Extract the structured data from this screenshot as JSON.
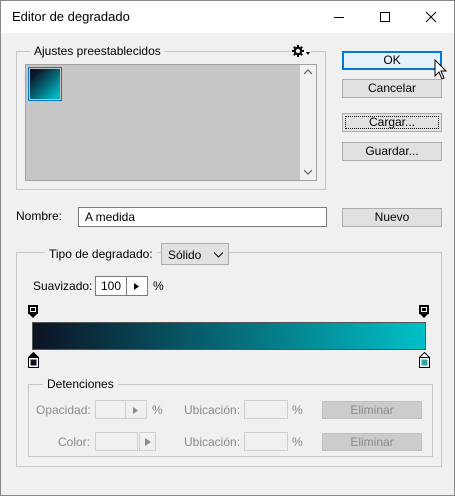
{
  "window": {
    "title": "Editor de degradado"
  },
  "presets": {
    "legend": "Ajustes preestablecidos",
    "gear_icon": "gear-icon",
    "selected_preset": {
      "from": "#0b1628",
      "to": "#00b7c3"
    }
  },
  "buttons": {
    "ok": "OK",
    "cancel": "Cancelar",
    "load": "Cargar...",
    "save": "Guardar...",
    "new": "Nuevo"
  },
  "name": {
    "label": "Nombre:",
    "value": "A medida"
  },
  "gradient_type": {
    "label": "Tipo de degradado:",
    "value": "Sólido"
  },
  "smoothness": {
    "label": "Suavizado:",
    "value": "100",
    "unit": "%"
  },
  "gradient": {
    "from": "#0c1324",
    "to": "#00c0c8"
  },
  "stops": {
    "legend": "Detenciones",
    "opacity_label": "Opacidad:",
    "opacity_unit": "%",
    "location_label_1": "Ubicación:",
    "location_unit_1": "%",
    "delete_1": "Eliminar",
    "color_label": "Color:",
    "location_label_2": "Ubicación:",
    "location_unit_2": "%",
    "delete_2": "Eliminar"
  },
  "colors": {
    "accent": "#0078d7",
    "right_stop": "#2aa8b0"
  }
}
